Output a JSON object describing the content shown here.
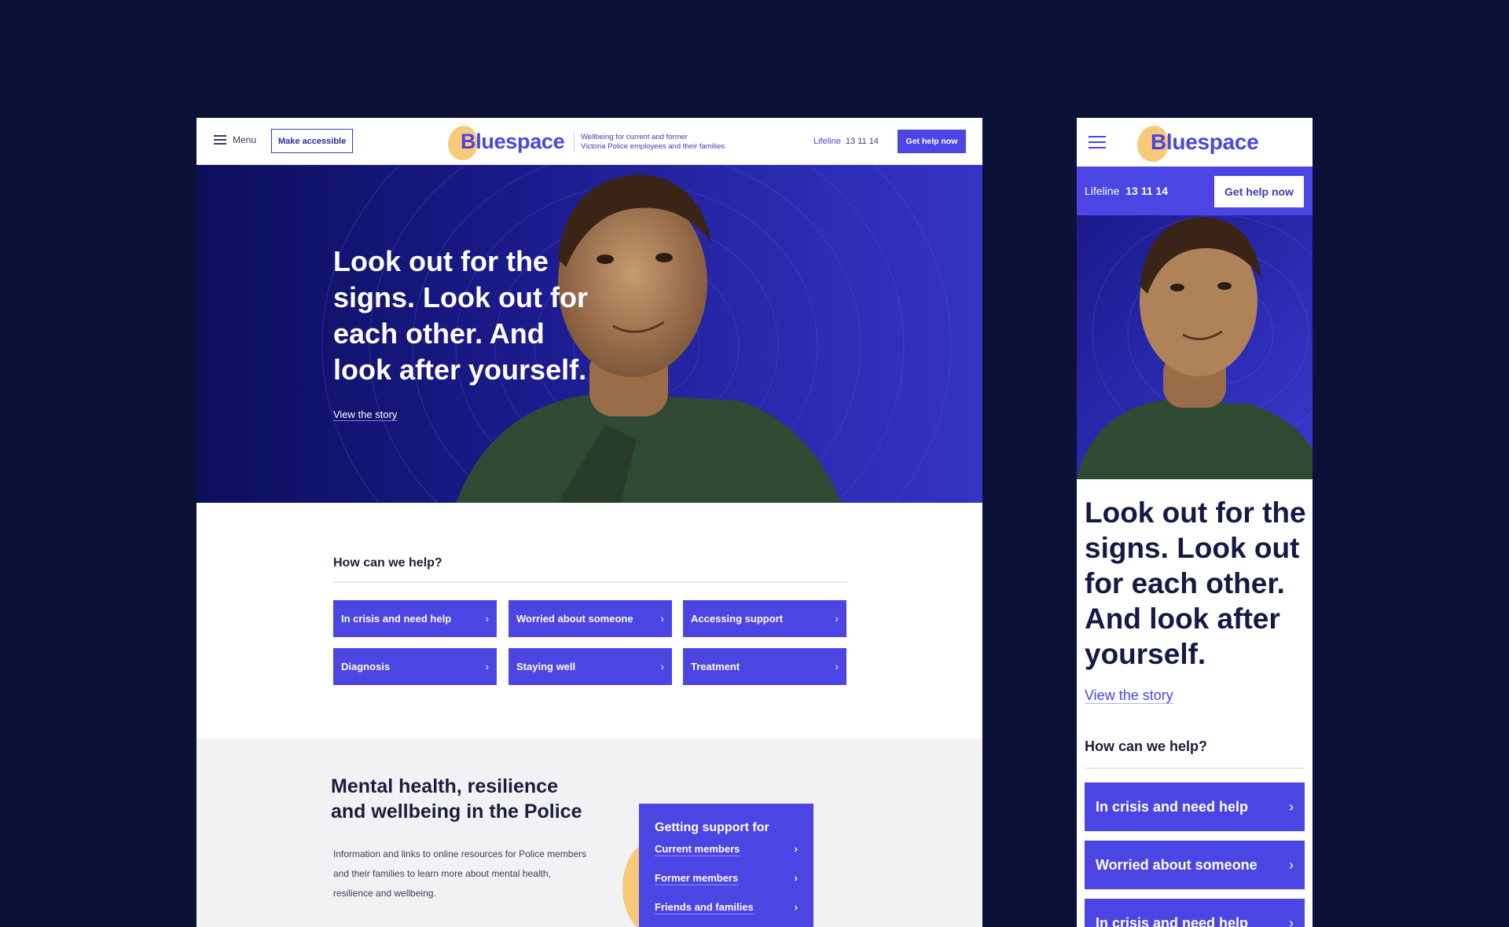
{
  "desktop": {
    "header": {
      "menu_label": "Menu",
      "accessible_label": "Make accessible",
      "brand": "Bluespace",
      "tagline_line1": "Wellbeing for current and former",
      "tagline_line2": "Victoria Police employees and their families",
      "lifeline_label": "Lifeline",
      "lifeline_number": "13 11 14",
      "get_help_label": "Get help now"
    },
    "hero": {
      "title": "Look out for the signs. Look out for each other. And look after yourself.",
      "link": "View the story"
    },
    "help": {
      "title": "How can we help?",
      "tiles": [
        "In crisis and need help",
        "Worried about someone",
        "Accessing support",
        "Diagnosis",
        "Staying well",
        "Treatment"
      ]
    },
    "mental_health": {
      "title": "Mental health, resilience and wellbeing in the Police",
      "body": "Information and links to online resources for Police members and their families to learn more about mental health, resilience and wellbeing.",
      "support_title": "Getting support for",
      "support_links": [
        "Current members",
        "Former members",
        "Friends and families"
      ]
    }
  },
  "mobile": {
    "brand": "Bluespace",
    "lifeline_label": "Lifeline",
    "lifeline_number": "13 11 14",
    "get_help_label": "Get help now",
    "hero_title": "Look out for the signs. Look out for each other. And look after yourself.",
    "hero_link": "View the story",
    "help_title": "How can we help?",
    "tiles": [
      "In crisis and need help",
      "Worried about someone",
      "In crisis and need help"
    ]
  },
  "icons": {
    "chevron": "›",
    "menu": "hamburger-icon"
  },
  "colors": {
    "page_bg": "#0b1137",
    "primary": "#4b45e3",
    "logo_blob": "#f8c978",
    "text_dark": "#1c1d3e"
  }
}
